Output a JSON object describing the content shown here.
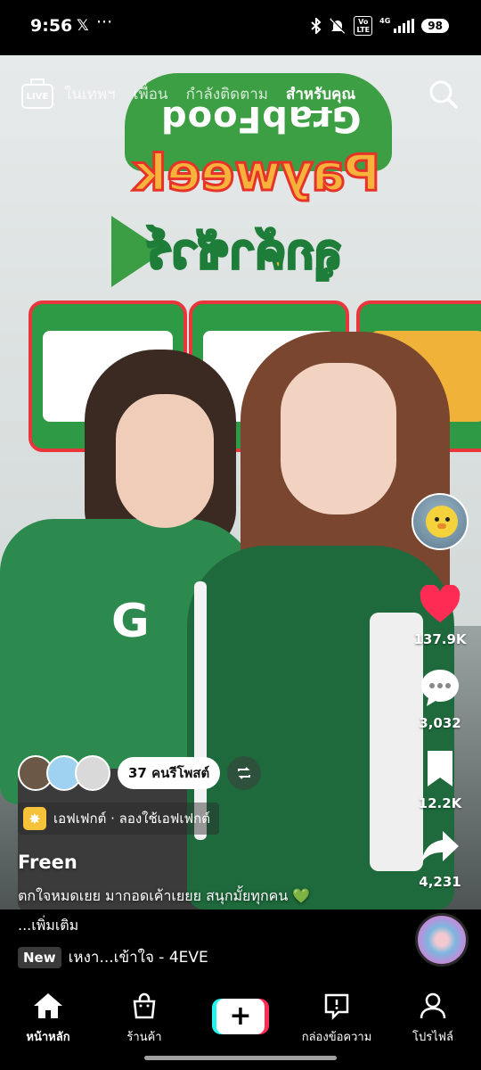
{
  "status_bar": {
    "time": "9:56",
    "x_icon": "𝕏",
    "dots": "···",
    "volte": "Vo\nLTE",
    "network": "4G",
    "battery": "98"
  },
  "top_nav": {
    "live_label": "LIVE",
    "tabs": [
      {
        "label": "ในเทพฯ"
      },
      {
        "label": "เพื่อน"
      },
      {
        "label": "กำลังติดตาม"
      },
      {
        "label": "สำหรับคุณ"
      }
    ]
  },
  "video_backdrop": {
    "brand": "GrabFood",
    "campaign": "Payweek",
    "campaign_thai": "ลูกค้าชัวร์"
  },
  "actions": {
    "likes": "137.9K",
    "comments": "3,032",
    "saves": "12.2K",
    "shares": "4,231"
  },
  "reposts": {
    "label": "37 คนรีโพสต์"
  },
  "effect": {
    "label": "เอฟเฟกต์ · ลองใช้เอฟเฟกต์"
  },
  "post": {
    "username": "Freen",
    "caption": "ตกใจหมดเยย มากอดเค้าเยยย สนุกมั้ยทุกคน",
    "caption_emoji": "💚",
    "more": "...เพิ่มเติม"
  },
  "music": {
    "badge": "New",
    "title": "เหงา...เข้าใจ - 4EVE"
  },
  "bottom_nav": {
    "home": "หน้าหลัก",
    "shop": "ร้านค้า",
    "create": "+",
    "inbox": "กล่องข้อความ",
    "profile": "โปรไฟล์"
  },
  "colors": {
    "like_red": "#fe2c55",
    "create_cyan": "#25f4ee",
    "create_pink": "#fe2c55"
  }
}
